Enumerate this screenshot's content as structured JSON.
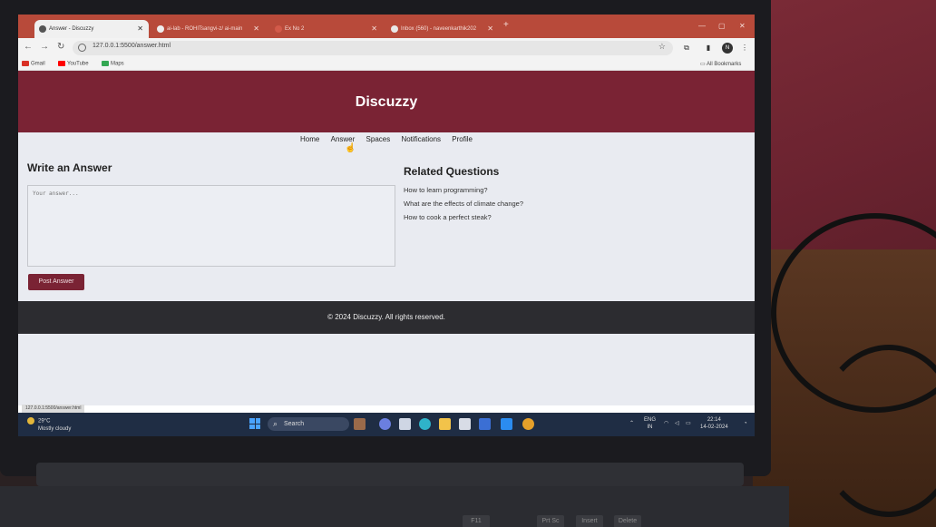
{
  "browser": {
    "tabs": [
      {
        "label": "Answer - Discuzzy",
        "active": true
      },
      {
        "label": "ai-lab - ROHITsangvi-z/ ai-main",
        "active": false
      },
      {
        "label": "Ex No 2",
        "active": false
      },
      {
        "label": "Inbox (560) - naveenkarthik202",
        "active": false
      }
    ],
    "address": "127.0.0.1:5500/answer.html",
    "bookmarks": [
      "Gmail",
      "YouTube",
      "Maps"
    ],
    "all_bookmarks": "All Bookmarks",
    "profile_initial": "N"
  },
  "site": {
    "title": "Discuzzy",
    "nav": [
      "Home",
      "Answer",
      "Spaces",
      "Notifications",
      "Profile"
    ],
    "write_heading": "Write an Answer",
    "answer_placeholder": "Your answer...",
    "post_button": "Post Answer",
    "related_heading": "Related Questions",
    "related": [
      "How to learn programming?",
      "What are the effects of climate change?",
      "How to cook a perfect steak?"
    ],
    "footer": "© 2024 Discuzzy. All rights reserved."
  },
  "status_url": "127.0.0.1:5500/answer.html",
  "taskbar": {
    "weather_temp": "29°C",
    "weather_desc": "Mostly cloudy",
    "search_label": "Search",
    "lang_top": "ENG",
    "lang_bottom": "IN",
    "time": "22:14",
    "date": "14-02-2024"
  },
  "keyboard_keys": [
    "F11",
    "Prt Sc",
    "Insert",
    "Delete"
  ],
  "colors": {
    "header": "#7a2334",
    "footer": "#2c2c30",
    "tabstrip": "#b84a3a"
  }
}
